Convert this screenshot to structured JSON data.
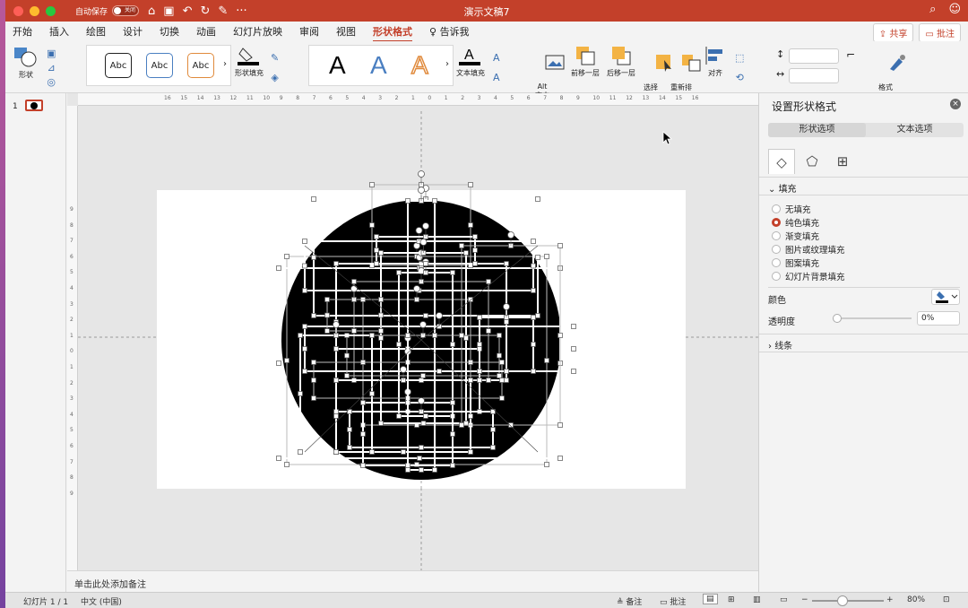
{
  "window": {
    "title": "演示文稿7",
    "autosave_label": "自动保存",
    "autosave_state": "关闭"
  },
  "menu_tabs": [
    "开始",
    "插入",
    "绘图",
    "设计",
    "切换",
    "动画",
    "幻灯片放映",
    "审阅",
    "视图",
    "形状格式"
  ],
  "tell_me": "告诉我",
  "share_label": "共享",
  "comments_label": "批注",
  "ribbon": {
    "shapes_label": "形状",
    "style_samples": [
      "Abc",
      "Abc",
      "Abc"
    ],
    "shape_fill_label": "形状填充",
    "wordart_samples": [
      "A",
      "A",
      "A"
    ],
    "text_fill_label": "文本填充",
    "alt_text_label": "Alt\n文本",
    "bring_forward_label": "前移一层",
    "send_backward_label": "后移一层",
    "selection_pane_label": "选择\n窗格",
    "reorder_label": "重新排\n序对象",
    "align_label": "对齐",
    "format_pane_label": "格式\n窗格"
  },
  "slides": {
    "current_number": "1"
  },
  "notes_placeholder": "单击此处添加备注",
  "ruler_h": [
    "16",
    "15",
    "14",
    "13",
    "12",
    "11",
    "10",
    "9",
    "8",
    "7",
    "6",
    "5",
    "4",
    "3",
    "2",
    "1",
    "0",
    "1",
    "2",
    "3",
    "4",
    "5",
    "6",
    "7",
    "8",
    "9",
    "10",
    "11",
    "12",
    "13",
    "14",
    "15",
    "16"
  ],
  "ruler_v": [
    "9",
    "8",
    "7",
    "6",
    "5",
    "4",
    "3",
    "2",
    "1",
    "0",
    "1",
    "2",
    "3",
    "4",
    "5",
    "6",
    "7",
    "8",
    "9"
  ],
  "format_pane": {
    "title": "设置形状格式",
    "tabs": [
      "形状选项",
      "文本选项"
    ],
    "fill_section": "填充",
    "fill_options": [
      "无填充",
      "纯色填充",
      "渐变填充",
      "图片或纹理填充",
      "图案填充",
      "幻灯片背景填充"
    ],
    "selected_fill": "纯色填充",
    "color_label": "颜色",
    "transparency_label": "透明度",
    "transparency_value": "0%",
    "line_section": "线条"
  },
  "status": {
    "slide_info": "幻灯片 1 / 1",
    "language": "中文 (中国)",
    "notes_label": "备注",
    "comments_label": "批注",
    "zoom": "80%"
  },
  "colors": {
    "accent": "#c3402a",
    "shape_fill": "#000000"
  }
}
